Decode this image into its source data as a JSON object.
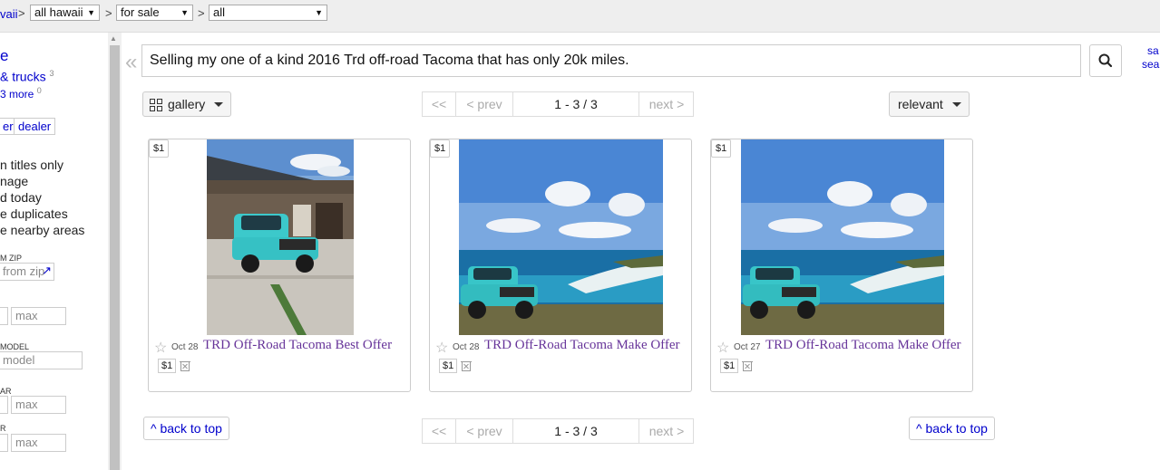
{
  "breadcrumb": {
    "region_prefix": "vaii",
    "sep1": ">",
    "region_select": "all hawaii",
    "sep2": ">",
    "category_select": "for sale",
    "sep3": ">",
    "subcategory_select": "all"
  },
  "sidebar": {
    "heading": "e",
    "link1": "& trucks",
    "link1_count": "3",
    "link2": "3 more",
    "link2_count": "0",
    "owner_btn": "er",
    "dealer_btn": "dealer",
    "options": [
      "n titles only",
      "nage",
      "d today",
      "e duplicates",
      "e nearby areas"
    ],
    "zip_label": "M ZIP",
    "zip_placeholder": "from zip",
    "max_placeholder": "max",
    "model_label": "MODEL",
    "model_placeholder": "model",
    "year_label": "AR",
    "year_max_placeholder": "max",
    "odo_label": "R",
    "odo_max_placeholder": "max"
  },
  "search": {
    "query": "Selling my one of a kind 2016 Trd off-road Tacoma that has only 20k miles.",
    "right_link_1": "sa",
    "right_link_2": "sea"
  },
  "toolbar": {
    "view_label": "gallery",
    "sort_label": "relevant"
  },
  "pager": {
    "first": "<<",
    "prev": "< prev",
    "range": "1 - 3 / 3",
    "next": "next >"
  },
  "listings": [
    {
      "badge": "$1",
      "date": "Oct 28",
      "title": "TRD Off-Road Tacoma Best Offer",
      "price": "$1"
    },
    {
      "badge": "$1",
      "date": "Oct 28",
      "title": "TRD Off-Road Tacoma Make Offer",
      "price": "$1"
    },
    {
      "badge": "$1",
      "date": "Oct 27",
      "title": "TRD Off-Road Tacoma Make Offer",
      "price": "$1"
    }
  ],
  "footer": {
    "back_to_top": "^ back to top"
  },
  "colors": {
    "link": "#0000cc",
    "visited_title": "#663399",
    "truck_teal": "#36c6c9"
  }
}
